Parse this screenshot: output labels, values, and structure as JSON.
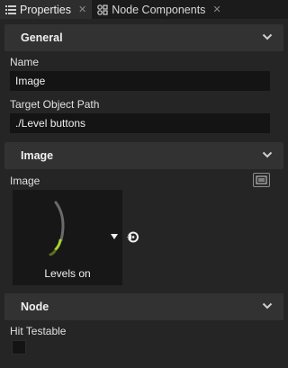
{
  "tabs": [
    {
      "label": "Properties",
      "icon": "list-icon",
      "active": true
    },
    {
      "label": "Node Components",
      "icon": "components-icon",
      "active": false
    }
  ],
  "sections": {
    "general": {
      "title": "General"
    },
    "image": {
      "title": "Image"
    },
    "node": {
      "title": "Node"
    }
  },
  "fields": {
    "name": {
      "label": "Name",
      "value": "Image"
    },
    "target_path": {
      "label": "Target Object Path",
      "value": "./Level buttons"
    },
    "image": {
      "label": "Image",
      "thumbnail_caption": "Levels on"
    },
    "hit_testable": {
      "label": "Hit Testable",
      "checked": false
    }
  },
  "colors": {
    "background": "#252525",
    "section_header": "#323232",
    "field_bg": "#141414",
    "accent_green": "#a8d42c"
  }
}
